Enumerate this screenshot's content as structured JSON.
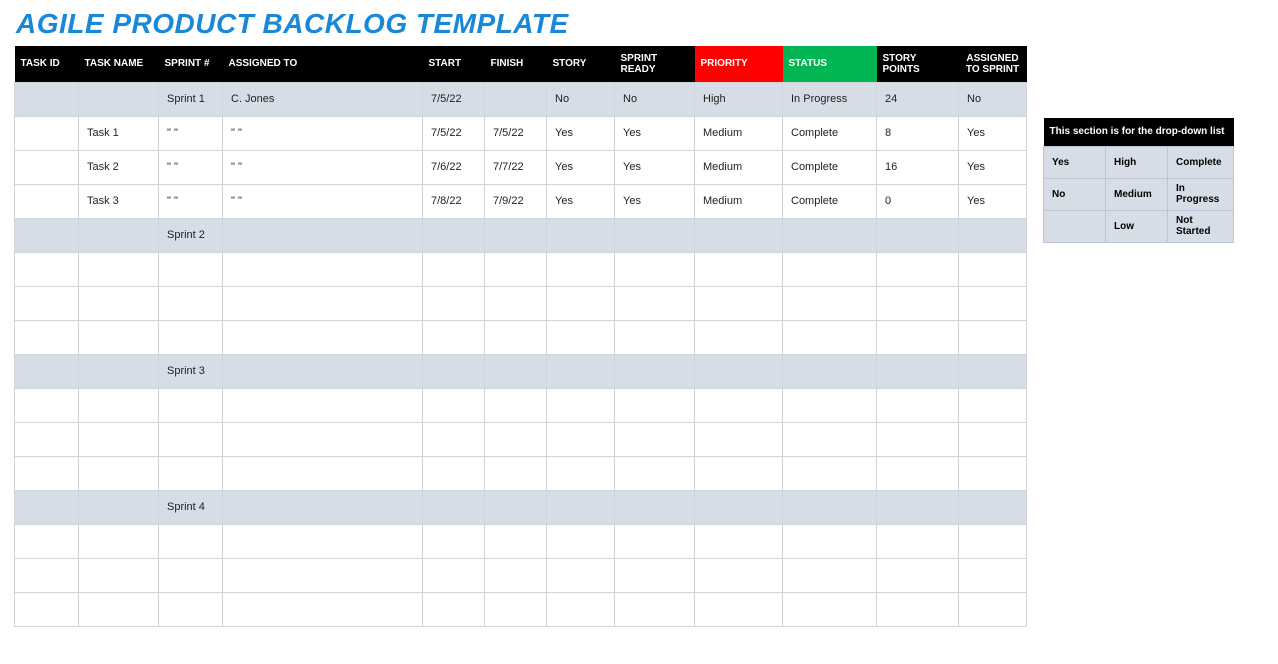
{
  "title": "AGILE PRODUCT BACKLOG TEMPLATE",
  "main": {
    "headers": {
      "task_id": "TASK ID",
      "task_name": "TASK NAME",
      "sprint": "SPRINT #",
      "assigned": "ASSIGNED TO",
      "start": "START",
      "finish": "FINISH",
      "story": "STORY",
      "sprint_ready": "SPRINT READY",
      "priority": "PRIORITY",
      "status": "STATUS",
      "points": "STORY POINTS",
      "to_sprint": "ASSIGNED TO SPRINT"
    },
    "rows": [
      {
        "shade": true,
        "task_id": "",
        "task_name": "",
        "sprint": "Sprint 1",
        "assigned": "C. Jones",
        "start": "7/5/22",
        "finish": "",
        "story": "No",
        "sprint_ready": "No",
        "priority": "High",
        "status": "In Progress",
        "points": "24",
        "to_sprint": "No"
      },
      {
        "shade": false,
        "task_id": "",
        "task_name": "Task 1",
        "sprint": "\" \"",
        "assigned": "\" \"",
        "start": "7/5/22",
        "finish": "7/5/22",
        "story": "Yes",
        "sprint_ready": "Yes",
        "priority": "Medium",
        "status": "Complete",
        "points": "8",
        "to_sprint": "Yes"
      },
      {
        "shade": false,
        "task_id": "",
        "task_name": "Task 2",
        "sprint": "\" \"",
        "assigned": "\" \"",
        "start": "7/6/22",
        "finish": "7/7/22",
        "story": "Yes",
        "sprint_ready": "Yes",
        "priority": "Medium",
        "status": "Complete",
        "points": "16",
        "to_sprint": "Yes"
      },
      {
        "shade": false,
        "task_id": "",
        "task_name": "Task 3",
        "sprint": "\" \"",
        "assigned": "\" \"",
        "start": "7/8/22",
        "finish": "7/9/22",
        "story": "Yes",
        "sprint_ready": "Yes",
        "priority": "Medium",
        "status": "Complete",
        "points": "0",
        "to_sprint": "Yes"
      },
      {
        "shade": true,
        "task_id": "",
        "task_name": "",
        "sprint": "Sprint 2",
        "assigned": "",
        "start": "",
        "finish": "",
        "story": "",
        "sprint_ready": "",
        "priority": "",
        "status": "",
        "points": "",
        "to_sprint": ""
      },
      {
        "shade": false,
        "task_id": "",
        "task_name": "",
        "sprint": "",
        "assigned": "",
        "start": "",
        "finish": "",
        "story": "",
        "sprint_ready": "",
        "priority": "",
        "status": "",
        "points": "",
        "to_sprint": ""
      },
      {
        "shade": false,
        "task_id": "",
        "task_name": "",
        "sprint": "",
        "assigned": "",
        "start": "",
        "finish": "",
        "story": "",
        "sprint_ready": "",
        "priority": "",
        "status": "",
        "points": "",
        "to_sprint": ""
      },
      {
        "shade": false,
        "task_id": "",
        "task_name": "",
        "sprint": "",
        "assigned": "",
        "start": "",
        "finish": "",
        "story": "",
        "sprint_ready": "",
        "priority": "",
        "status": "",
        "points": "",
        "to_sprint": ""
      },
      {
        "shade": true,
        "task_id": "",
        "task_name": "",
        "sprint": "Sprint 3",
        "assigned": "",
        "start": "",
        "finish": "",
        "story": "",
        "sprint_ready": "",
        "priority": "",
        "status": "",
        "points": "",
        "to_sprint": ""
      },
      {
        "shade": false,
        "task_id": "",
        "task_name": "",
        "sprint": "",
        "assigned": "",
        "start": "",
        "finish": "",
        "story": "",
        "sprint_ready": "",
        "priority": "",
        "status": "",
        "points": "",
        "to_sprint": ""
      },
      {
        "shade": false,
        "task_id": "",
        "task_name": "",
        "sprint": "",
        "assigned": "",
        "start": "",
        "finish": "",
        "story": "",
        "sprint_ready": "",
        "priority": "",
        "status": "",
        "points": "",
        "to_sprint": ""
      },
      {
        "shade": false,
        "task_id": "",
        "task_name": "",
        "sprint": "",
        "assigned": "",
        "start": "",
        "finish": "",
        "story": "",
        "sprint_ready": "",
        "priority": "",
        "status": "",
        "points": "",
        "to_sprint": ""
      },
      {
        "shade": true,
        "task_id": "",
        "task_name": "",
        "sprint": "Sprint 4",
        "assigned": "",
        "start": "",
        "finish": "",
        "story": "",
        "sprint_ready": "",
        "priority": "",
        "status": "",
        "points": "",
        "to_sprint": ""
      },
      {
        "shade": false,
        "task_id": "",
        "task_name": "",
        "sprint": "",
        "assigned": "",
        "start": "",
        "finish": "",
        "story": "",
        "sprint_ready": "",
        "priority": "",
        "status": "",
        "points": "",
        "to_sprint": ""
      },
      {
        "shade": false,
        "task_id": "",
        "task_name": "",
        "sprint": "",
        "assigned": "",
        "start": "",
        "finish": "",
        "story": "",
        "sprint_ready": "",
        "priority": "",
        "status": "",
        "points": "",
        "to_sprint": ""
      },
      {
        "shade": false,
        "task_id": "",
        "task_name": "",
        "sprint": "",
        "assigned": "",
        "start": "",
        "finish": "",
        "story": "",
        "sprint_ready": "",
        "priority": "",
        "status": "",
        "points": "",
        "to_sprint": ""
      }
    ]
  },
  "dropdown": {
    "title": "This section is for the drop-down list",
    "rows": [
      [
        "Yes",
        "High",
        "Complete"
      ],
      [
        "No",
        "Medium",
        "In Progress"
      ],
      [
        "",
        "Low",
        "Not Started"
      ]
    ]
  }
}
